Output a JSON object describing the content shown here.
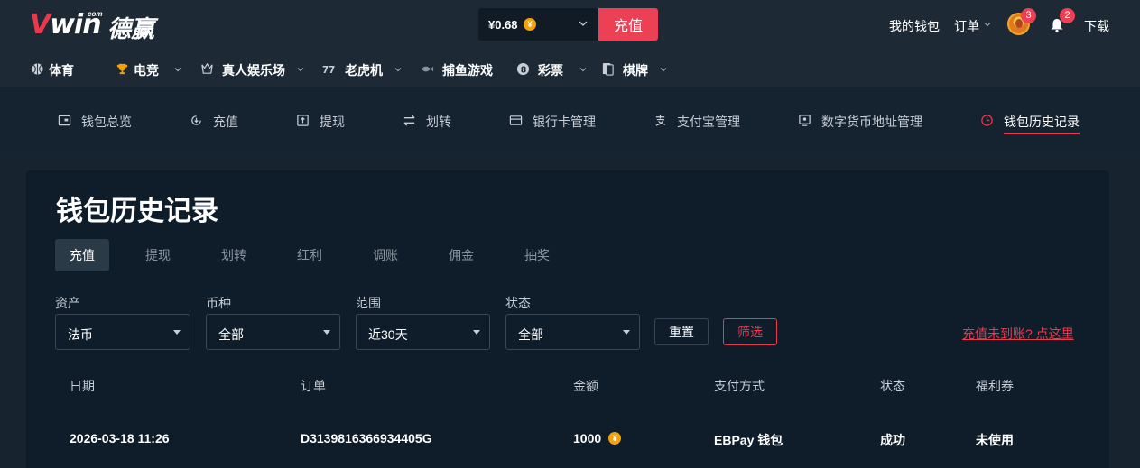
{
  "header": {
    "logo_text_v": "V",
    "logo_text_rest": "win",
    "logo_com": "com",
    "logo_cn": "德赢",
    "balance": "¥0.68",
    "coin_symbol": "¥",
    "recharge_label": "充值",
    "my_wallet": "我的钱包",
    "orders": "订单",
    "avatar_badge": "3",
    "bell_badge": "2",
    "download": "下载"
  },
  "nav": [
    {
      "label": "体育",
      "icon": "basketball-icon"
    },
    {
      "label": "电竞",
      "icon": "trophy-icon"
    },
    {
      "label": "真人娱乐场",
      "icon": "crown-icon"
    },
    {
      "label": "老虎机",
      "icon": "slot-icon"
    },
    {
      "label": "捕鱼游戏",
      "icon": "fish-icon"
    },
    {
      "label": "彩票",
      "icon": "lottery-ball-icon"
    },
    {
      "label": "棋牌",
      "icon": "cards-icon"
    }
  ],
  "subnav": [
    {
      "label": "钱包总览",
      "icon": "wallet-icon"
    },
    {
      "label": "充值",
      "icon": "deposit-icon"
    },
    {
      "label": "提现",
      "icon": "withdraw-icon"
    },
    {
      "label": "划转",
      "icon": "transfer-icon"
    },
    {
      "label": "银行卡管理",
      "icon": "bank-card-icon"
    },
    {
      "label": "支付宝管理",
      "icon": "alipay-icon"
    },
    {
      "label": "数字货币地址管理",
      "icon": "crypto-address-icon"
    },
    {
      "label": "钱包历史记录",
      "icon": "clock-icon",
      "active": true
    }
  ],
  "main": {
    "title": "钱包历史记录",
    "tabs": [
      "充值",
      "提现",
      "划转",
      "红利",
      "调账",
      "佣金",
      "抽奖"
    ],
    "filters": {
      "asset": {
        "label": "资产",
        "value": "法币"
      },
      "currency": {
        "label": "币种",
        "value": "全部"
      },
      "range": {
        "label": "范围",
        "value": "近30天"
      },
      "status": {
        "label": "状态",
        "value": "全部"
      }
    },
    "reset_label": "重置",
    "filter_label": "筛选",
    "help_link": "充值未到账? 点这里",
    "table": {
      "columns": [
        "日期",
        "订单",
        "金额",
        "支付方式",
        "状态",
        "福利券"
      ],
      "rows": [
        [
          "2026-03-18 11:26",
          "D3139816366934405G",
          "1000",
          "EBPay 钱包",
          "成功",
          "未使用"
        ]
      ]
    }
  },
  "colors": {
    "accent": "#e8394d",
    "coin": "#f2a20c",
    "header_bg": "#1d2a35",
    "panel_bg": "#0f1d2a"
  }
}
